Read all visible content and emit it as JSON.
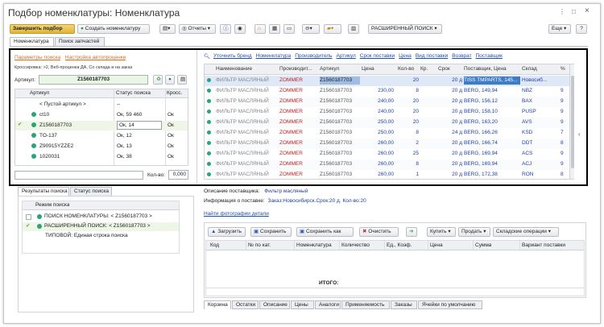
{
  "window": {
    "title": "Подбор номенклатуры: Номенклатура",
    "controls": [
      "⋮",
      "□",
      "×"
    ]
  },
  "toolbar": {
    "finish_label": "Завершить подбор",
    "create_label": "Создать номенклатуру",
    "print_label": "",
    "reports_label": "Отчеты",
    "ext_search_label": "РАСШИРЕННЫЙ ПОИСК",
    "more_label": "Еще",
    "help_label": "?"
  },
  "main_tabs": [
    "Номенклатура",
    "Поиск запчастей"
  ],
  "left_panel": {
    "links": [
      "Параметры поиска",
      "Настройка автопроценки"
    ],
    "criteria": "Кроссировка: >2, Веб-проценка:ДА, Со склада и на заказ",
    "article_label": "Артикул:",
    "article_value": "Z1560187703",
    "table_headers": [
      "Артикул",
      "Статус поиска",
      "Кросс."
    ],
    "rows": [
      {
        "article": "< Пустой артикул >",
        "status": "--",
        "cross": "",
        "dot": false,
        "check": false
      },
      {
        "article": "ct10",
        "status": "Ок, 59 460",
        "cross": "Ок",
        "dot": true,
        "check": false
      },
      {
        "article": "Z1560187703",
        "status": "Ок, 14",
        "cross": "Ок",
        "dot": true,
        "check": true
      },
      {
        "article": "TO-137",
        "status": "Ок, 12",
        "cross": "Ок",
        "dot": true,
        "check": false
      },
      {
        "article": "Z90915YZZE2",
        "status": "Ок, 13",
        "cross": "Ок",
        "dot": true,
        "check": false
      },
      {
        "article": "1020031",
        "status": "Ок, 38",
        "cross": "Ок",
        "dot": true,
        "check": false
      }
    ],
    "qty_label": "Кол-во:",
    "qty_value": "0,000"
  },
  "filter_links": [
    "Уточнить бренд",
    "Номенклатура",
    "Производитель",
    "Артикул",
    "Срок поставки",
    "Цена",
    "Вид поставки",
    "Возврат",
    "Поставщик"
  ],
  "results": {
    "headers": [
      "Наименование",
      "Производит...",
      "Артикул",
      "Цена",
      "Кол-во",
      "Кр.",
      "Срок",
      "Поставщик, Цена",
      "Склад",
      "%"
    ],
    "rows": [
      {
        "name": "ФИЛЬТР МАСЛЯНЫЙ",
        "maker": "ZOMMER",
        "article": "Z1560187703",
        "price": "",
        "qty": "20",
        "kr": "",
        "term": "20 д",
        "supplier": "TISS TMPARTS, 145...",
        "stock": "Новосиб...",
        "pct": "",
        "selected": true
      },
      {
        "name": "ФИЛЬТР МАСЛЯНЫЙ",
        "maker": "ZOMMER",
        "article": "Z1560187703",
        "price": "230,00",
        "qty": "8",
        "kr": "",
        "term": "20 д",
        "supplier": "BERG, 149,94",
        "stock": "NBZ",
        "pct": "9",
        "selected": false
      },
      {
        "name": "ФИЛЬТР МАСЛЯНЫЙ",
        "maker": "ZOMMER",
        "article": "Z1560187703",
        "price": "240,00",
        "qty": "20",
        "kr": "",
        "term": "20 д",
        "supplier": "BERG, 156,12",
        "stock": "BAX",
        "pct": "9",
        "selected": false
      },
      {
        "name": "ФИЛЬТР МАСЛЯНЫЙ",
        "maker": "ZOMMER",
        "article": "Z1560187703",
        "price": "240,00",
        "qty": "20",
        "kr": "",
        "term": "20 д",
        "supplier": "BERG, 158,10",
        "stock": "PUSP",
        "pct": "9",
        "selected": false
      },
      {
        "name": "ФИЛЬТР МАСЛЯНЫЙ",
        "maker": "ZOMMER",
        "article": "Z1560187703",
        "price": "250,00",
        "qty": "20",
        "kr": "",
        "term": "20 д",
        "supplier": "BERG, 163,20",
        "stock": "AVS",
        "pct": "9",
        "selected": false
      },
      {
        "name": "ФИЛЬТР МАСЛЯНЫЙ",
        "maker": "ZOMMER",
        "article": "Z1560187703",
        "price": "250,00",
        "qty": "8",
        "kr": "",
        "term": "24 д",
        "supplier": "BERG, 166,26",
        "stock": "KSD",
        "pct": "7",
        "selected": false
      },
      {
        "name": "ФИЛЬТР МАСЛЯНЫЙ",
        "maker": "ZOMMER",
        "article": "Z1560187703",
        "price": "260,00",
        "qty": "2",
        "kr": "",
        "term": "20 д",
        "supplier": "BERG, 166,74",
        "stock": "DDT",
        "pct": "8",
        "selected": false
      },
      {
        "name": "ФИЛЬТР МАСЛЯНЫЙ",
        "maker": "ZOMMER",
        "article": "Z1560187703",
        "price": "260,00",
        "qty": "25",
        "kr": "",
        "term": "20 д",
        "supplier": "BERG, 169,94",
        "stock": "ACS",
        "pct": "9",
        "selected": false
      },
      {
        "name": "ФИЛЬТР МАСЛЯНЫЙ",
        "maker": "ZOMMER",
        "article": "Z1560187703",
        "price": "260,00",
        "qty": "8",
        "kr": "",
        "term": "20 д",
        "supplier": "BERG, 169,94",
        "stock": "ACJ",
        "pct": "9",
        "selected": false
      },
      {
        "name": "ФИЛЬТР МАСЛЯНЫЙ",
        "maker": "ZOMMER",
        "article": "Z1560187703",
        "price": "260,00",
        "qty": "1",
        "kr": "",
        "term": "20 д",
        "supplier": "BERG, 172,38",
        "stock": "RON",
        "pct": "8",
        "selected": false
      }
    ]
  },
  "search_results": {
    "tabs": [
      "Результаты поиска",
      "Статус поиска"
    ],
    "header": "Режим поиска",
    "items": [
      {
        "text": "ПОИСК НОМЕНКЛАТУРЫ: < Z1560187703 >",
        "check": false
      },
      {
        "text": "РАСШИРЕННЫЙ ПОИСК: < Z1560187703 >",
        "check": true
      },
      {
        "text": "ТИПОВОЙ: Единая строка поиска",
        "check": null
      }
    ]
  },
  "supplier_info": {
    "desc_label": "Описание поставщика:",
    "desc_value": "Фильтр масляный",
    "info_label": "Информация о поставке:",
    "info_value": "Заказ:Новосибирск.Срок:20 д. Кол-во:20",
    "photos_link": "Найти фотографии детали"
  },
  "cart_toolbar": {
    "load": "Загрузить",
    "save": "Сохранить",
    "save_as": "Сохранить как",
    "clear": "Очистить",
    "buy": "Купить",
    "sell": "Продать",
    "warehouse": "Складские операции"
  },
  "cart_table": {
    "headers": [
      "Код",
      "№ по кат.",
      "Номенклатура",
      "Количество",
      "Ед., Коэф.",
      "Цена",
      "Сумма",
      "Вариант поставки"
    ],
    "total_label": "ИТОГО:"
  },
  "bottom_tabs": [
    "Корзина",
    "Остатки",
    "Описание",
    "Цены",
    "Аналоги",
    "Применяемость",
    "Заказы",
    "Ячейки по умолчанию"
  ],
  "colors": {
    "accent": "#1e4fa8",
    "selected_row": "#3d7cc9",
    "brand_red": "#c02020",
    "frame": "#000000"
  }
}
